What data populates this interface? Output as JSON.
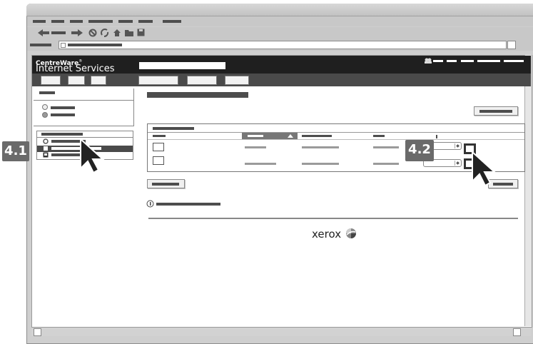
{
  "branding": {
    "line1": "CentreWare",
    "reg": "®",
    "line2": "Internet Services"
  },
  "steps": {
    "step1": "4.1",
    "step2": "4.2"
  },
  "footer": {
    "logo_text": "xerox"
  },
  "icons": {
    "back": "back-arrow-icon",
    "forward": "forward-arrow-icon",
    "stop": "stop-icon",
    "refresh": "refresh-icon",
    "home": "home-icon",
    "folder": "folder-icon",
    "save": "save-icon",
    "user": "user-icon",
    "info": "info-icon",
    "cursor": "pointer-cursor-icon"
  },
  "colors": {
    "header": "#1f1f1f",
    "nav": "#4a4a4a",
    "badge": "#6a6a6a",
    "selected_row": "#4a4a4a"
  }
}
